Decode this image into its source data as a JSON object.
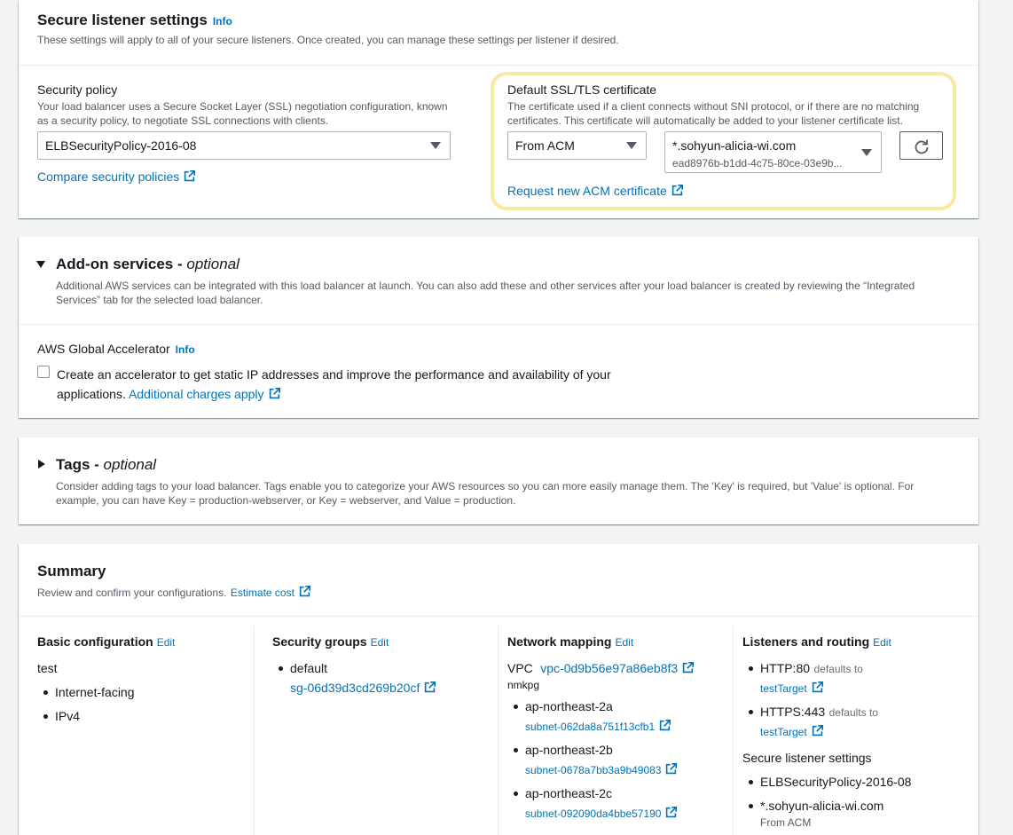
{
  "secure_listener": {
    "title": "Secure listener settings",
    "info": "Info",
    "description": "These settings will apply to all of your secure listeners. Once created, you can manage these settings per listener if desired.",
    "security_policy_label": "Security policy",
    "security_policy_desc_1": "Your load balancer uses a Secure Socket Layer (SSL) negotiation configuration, known",
    "security_policy_desc_2": "as a security policy, to negotiate SSL connections with clients.",
    "security_policy_value": "ELBSecurityPolicy-2016-08",
    "compare_link": "Compare security policies",
    "cert_label": "Default SSL/TLS certificate",
    "cert_desc_1": "The certificate used if a client connects without SNI protocol, or if there are no matching",
    "cert_desc_2": "certificates. This certificate will automatically be added to your listener certificate list.",
    "cert_source": "From ACM",
    "cert_domain": "*.sohyun-alicia-wi.com",
    "cert_id": "ead8976b-b1dd-4c75-80ce-03e9b...",
    "request_link": "Request new ACM certificate",
    "highlight_color": "#f8e8a0"
  },
  "addon": {
    "title": "Add-on services",
    "title_sep": " - ",
    "title_optional": "optional",
    "desc_1": "Additional AWS services can be integrated with this load balancer at launch. You can also add these and other services after your load balancer is created by reviewing the “Integrated",
    "desc_2": "Services” tab for the selected load balancer.",
    "accelerator_label": "AWS Global Accelerator",
    "info": "Info",
    "checkbox_text_1": "Create an accelerator to get static IP addresses and improve the performance and availability of your",
    "checkbox_text_2": "applications.",
    "charges_link": "Additional charges apply"
  },
  "tags": {
    "title": "Tags",
    "title_sep": " - ",
    "title_optional": "optional",
    "desc_1": "Consider adding tags to your load balancer. Tags enable you to categorize your AWS resources so you can more easily manage them. The 'Key' is required, but 'Value' is optional. For",
    "desc_2": "example, you can have Key = production-webserver, or Key = webserver, and Value = production."
  },
  "summary": {
    "title": "Summary",
    "desc": "Review and confirm your configurations.",
    "estimate_link": "Estimate cost",
    "edit": "Edit",
    "basic": {
      "heading": "Basic configuration",
      "name": "test",
      "items": [
        "Internet-facing",
        "IPv4"
      ]
    },
    "security_groups": {
      "heading": "Security groups",
      "item": "default",
      "sg_link": "sg-06d39d3cd269b20cf"
    },
    "network": {
      "heading": "Network mapping",
      "vpc_label": "VPC",
      "vpc_link": "vpc-0d9b56e97a86eb8f3",
      "vpc_name": "nmkpg",
      "zones": [
        {
          "az": "ap-northeast-2a",
          "subnet": "subnet-062da8a751f13cfb1"
        },
        {
          "az": "ap-northeast-2b",
          "subnet": "subnet-0678a7bb3a9b49083"
        },
        {
          "az": "ap-northeast-2c",
          "subnet": "subnet-092090da4bbe57190"
        }
      ]
    },
    "listeners": {
      "heading": "Listeners and routing",
      "items": [
        {
          "proto": "HTTP:80",
          "defaults": "defaults to",
          "target": "testTarget"
        },
        {
          "proto": "HTTPS:443",
          "defaults": "defaults to",
          "target": "testTarget"
        }
      ],
      "secure_heading": "Secure listener settings",
      "policy": "ELBSecurityPolicy-2016-08",
      "cert": "*.sohyun-alicia-wi.com",
      "cert_source": "From ACM"
    }
  },
  "colors": {
    "link": "#0073bb",
    "text": "#16191f",
    "muted": "#545b64",
    "background": "#f2f3f3"
  }
}
